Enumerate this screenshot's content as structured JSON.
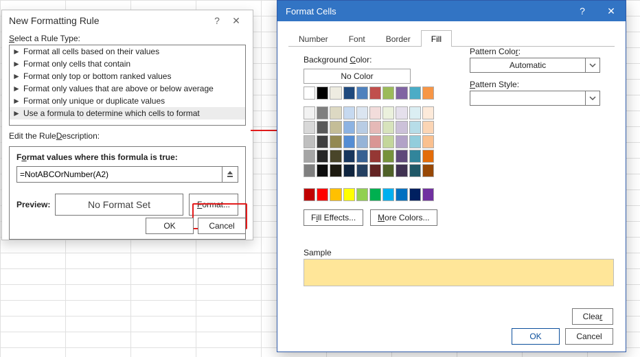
{
  "nfr": {
    "title": "New Formatting Rule",
    "selectLabel_pre": "S",
    "selectLabel_post": "elect a Rule Type:",
    "ruleTypes": [
      "Format all cells based on their values",
      "Format only cells that contain",
      "Format only top or bottom ranked values",
      "Format only values that are above or below average",
      "Format only unique or duplicate values",
      "Use a formula to determine which cells to format"
    ],
    "ruleTypeSelectedIndex": 5,
    "editLabel_pre": "Edit the Rule ",
    "editLabel_ul": "D",
    "editLabel_post": "escription:",
    "formulaLabel_pre": "F",
    "formulaLabel_mid": "o",
    "formulaLabel_post": "rmat values where this formula is true:",
    "formula": "=NotABCOrNumber(A2)",
    "previewLabel": "Preview:",
    "previewText": "No Format Set",
    "formatBtn_ul": "F",
    "formatBtn_post": "ormat...",
    "ok": "OK",
    "cancel": "Cancel"
  },
  "fc": {
    "title": "Format Cells",
    "tabs": [
      "Number",
      "Font",
      "Border",
      "Fill"
    ],
    "activeTabIndex": 3,
    "bgLabel_pre": "Background ",
    "bgLabel_ul": "C",
    "bgLabel_post": "olor:",
    "noColor": "No Color",
    "patternColor_pre": "Pattern Colo",
    "patternColor_ul": "r",
    "patternColor_post": ":",
    "patternColorValue": "Automatic",
    "patternStyle_pre": "",
    "patternStyle_ul": "P",
    "patternStyle_post": "attern Style:",
    "fillEffects_pre": "F",
    "fillEffects_ul": "i",
    "fillEffects_post": "ll Effects...",
    "moreColors_ul": "M",
    "moreColors_post": "ore Colors...",
    "sampleLabel": "Sample",
    "sampleColor": "#ffe699",
    "clear": "Clea",
    "clear_ul": "r",
    "ok": "OK",
    "cancel": "Cancel",
    "palette_standard": [
      [
        "#ffffff",
        "#000000",
        "#eeece1",
        "#1f497d",
        "#4f81bd",
        "#c0504d",
        "#9bbb59",
        "#8064a2",
        "#4bacc6",
        "#f79646"
      ]
    ],
    "palette_theme": [
      [
        "#f2f2f2",
        "#7f7f7f",
        "#ddd9c3",
        "#c6d9f0",
        "#dbe5f1",
        "#f2dcdb",
        "#ebf1dd",
        "#e5e0ec",
        "#dbeef3",
        "#fdeada"
      ],
      [
        "#d8d8d8",
        "#595959",
        "#c4bd97",
        "#8db3e2",
        "#b8cce4",
        "#e5b9b7",
        "#d7e3bc",
        "#ccc1d9",
        "#b7dde8",
        "#fbd5b5"
      ],
      [
        "#bfbfbf",
        "#3f3f3f",
        "#938953",
        "#548dd4",
        "#95b3d7",
        "#d99694",
        "#c3d69b",
        "#b2a2c7",
        "#92cddc",
        "#fac08f"
      ],
      [
        "#a5a5a5",
        "#262626",
        "#494529",
        "#17365d",
        "#366092",
        "#953734",
        "#76923c",
        "#5f497a",
        "#31859b",
        "#e36c09"
      ],
      [
        "#7f7f7f",
        "#0c0c0c",
        "#1d1b10",
        "#0f243e",
        "#244061",
        "#632423",
        "#4f6128",
        "#3f3151",
        "#205867",
        "#974806"
      ]
    ],
    "palette_std_row": [
      "#c00000",
      "#ff0000",
      "#ffc000",
      "#ffff00",
      "#92d050",
      "#00b050",
      "#00b0f0",
      "#0070c0",
      "#002060",
      "#7030a0"
    ]
  }
}
